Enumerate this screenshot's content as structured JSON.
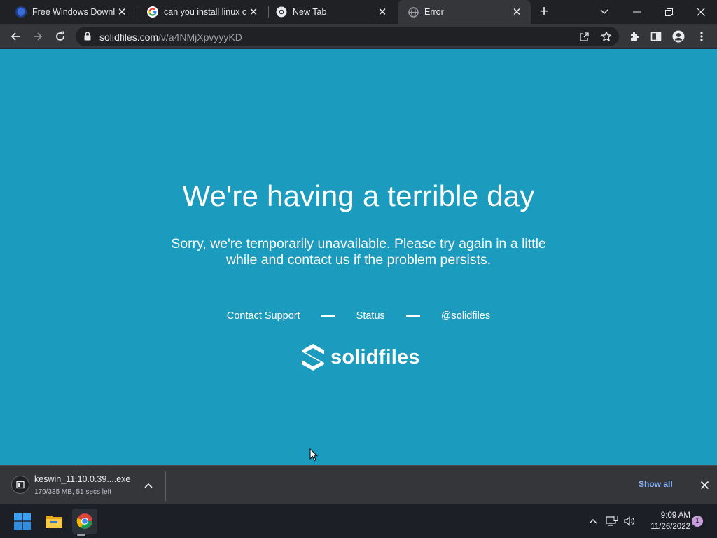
{
  "browser": {
    "tabs": [
      {
        "title": "Free Windows Downloa",
        "favicon": "blue-shield-icon",
        "active": false
      },
      {
        "title": "can you install linux on",
        "favicon": "google-icon",
        "active": false
      },
      {
        "title": "New Tab",
        "favicon": "chrome-icon",
        "active": false
      },
      {
        "title": "Error",
        "favicon": "globe-icon",
        "active": true
      }
    ],
    "url_host": "solidfiles.com",
    "url_path": "/v/a4NMjXpvyyyKD"
  },
  "page": {
    "headline": "We're having a terrible day",
    "message": "Sorry, we're temporarily unavailable. Please try again in a little while and contact us if the problem persists.",
    "links": {
      "contact": "Contact Support",
      "status": "Status",
      "twitter": "@solidfiles"
    },
    "brand": "solidfiles",
    "background_color": "#1b9bbd"
  },
  "download": {
    "filename": "keswin_11.10.0.39....exe",
    "status": "179/335 MB, 51 secs left",
    "show_all": "Show all"
  },
  "taskbar": {
    "time": "9:09 AM",
    "date": "11/26/2022",
    "notification_count": "1"
  }
}
